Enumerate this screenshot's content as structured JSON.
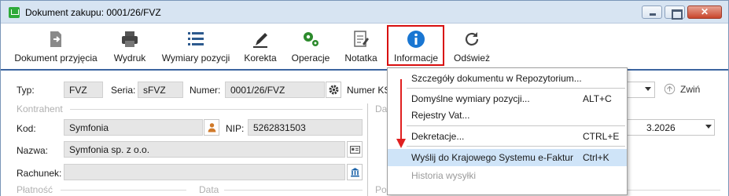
{
  "window": {
    "title": "Dokument zakupu: 0001/26/FVZ",
    "close_glyph": "✕"
  },
  "toolbar": {
    "items": [
      {
        "label": "Dokument przyjęcia",
        "icon": "document-receipt-icon"
      },
      {
        "label": "Wydruk",
        "icon": "printer-icon"
      },
      {
        "label": "Wymiary pozycji",
        "icon": "list-icon"
      },
      {
        "label": "Korekta",
        "icon": "pen-icon"
      },
      {
        "label": "Operacje",
        "icon": "gears-icon"
      },
      {
        "label": "Notatka",
        "icon": "note-icon"
      },
      {
        "label": "Informacje",
        "icon": "info-icon"
      },
      {
        "label": "Odśwież",
        "icon": "refresh-icon"
      }
    ],
    "highlight_color": "#d80f0f"
  },
  "form": {
    "typ_label": "Typ:",
    "typ_value": "FVZ",
    "seria_label": "Seria:",
    "seria_value": "sFVZ",
    "numer_label": "Numer:",
    "numer_value": "0001/26/FVZ",
    "numer_ks_label": "Numer KS",
    "zwin_label": "Zwiń",
    "kontrahent_section": "Kontrahent",
    "da_section_partial": "Da",
    "kod_label": "Kod:",
    "kod_value": "Symfonia",
    "nip_label": "NIP:",
    "nip_value": "5262831503",
    "date_partial": "3.2026",
    "nazwa_label": "Nazwa:",
    "nazwa_value": "Symfonia sp. z o.o.",
    "rachunek_label": "Rachunek:",
    "rachunek_value": "",
    "platnosc_section": "Płatność",
    "data_section": "Data",
    "pola_section": "Pola własne"
  },
  "menu": {
    "items": [
      {
        "label": "Szczegóły dokumentu w Repozytorium...",
        "shortcut": "",
        "state": "normal"
      },
      {
        "label": "Domyślne wymiary pozycji...",
        "shortcut": "ALT+C",
        "state": "normal"
      },
      {
        "label": "Rejestry Vat...",
        "shortcut": "",
        "state": "normal"
      },
      {
        "label": "Dekretacje...",
        "shortcut": "CTRL+E",
        "state": "normal"
      },
      {
        "label": "Wyślij do Krajowego Systemu e-Faktur",
        "shortcut": "Ctrl+K",
        "state": "highlighted"
      },
      {
        "label": "Historia wysyłki",
        "shortcut": "",
        "state": "disabled"
      }
    ],
    "highlight_color": "#cfe4f8",
    "arrow_color": "#e02020"
  }
}
